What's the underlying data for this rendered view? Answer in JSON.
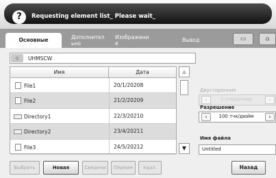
{
  "banner": {
    "message": "Requesting element list_ Please wait_",
    "icon": "help-icon"
  },
  "tabs": [
    {
      "label": "Основные",
      "active": true
    },
    {
      "label": "Дополнител\nьно"
    },
    {
      "label": "Изображени\nе"
    },
    {
      "label": "Вывод"
    }
  ],
  "toolbar": {
    "save_icon": "copy-icon",
    "home_icon": "home-icon"
  },
  "path": {
    "value": "UHMSCW"
  },
  "list": {
    "columns": [
      "Имя",
      "Дата"
    ],
    "rows": [
      {
        "name": "File1",
        "date": "20/1/20208",
        "type": "file"
      },
      {
        "name": "File2",
        "date": "21/2/20209",
        "type": "file"
      },
      {
        "name": "Directory1",
        "date": "22/3/20210",
        "type": "folder"
      },
      {
        "name": "Directory2",
        "date": "23/4/20211",
        "type": "folder"
      },
      {
        "name": "File3",
        "date": "24/5/20212",
        "type": "file"
      }
    ]
  },
  "buttons": {
    "select": "Выбрать",
    "new_folder": "Новая папка",
    "info": "Сведени",
    "rename": "Переим",
    "delete": "Удал.",
    "back": "Назад"
  },
  "options": {
    "duplex_label": "Двусторонние",
    "duplex_value": "1 сторонние",
    "resolution_label": "Разрешение",
    "resolution_value": "100 тчк/дюйм",
    "filename_label": "Имя файла",
    "filename_value": "Untitled"
  },
  "colors": {
    "banner": "#1b1b1b",
    "tabbar": "#9b9b9b",
    "selected_row": "#dcdcdc"
  }
}
